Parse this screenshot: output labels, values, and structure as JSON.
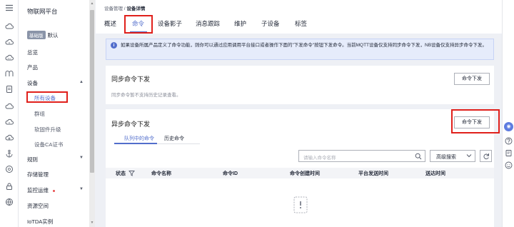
{
  "sidebar": {
    "title": "物联网平台",
    "instance_tag": "基础版",
    "instance_default": "默认",
    "items": [
      {
        "label": "总览"
      },
      {
        "label": "产品"
      },
      {
        "label": "设备"
      },
      {
        "label": "所有设备"
      },
      {
        "label": "群组"
      },
      {
        "label": "软固件升级"
      },
      {
        "label": "设备CA证书"
      },
      {
        "label": "规则"
      },
      {
        "label": "存储管理"
      },
      {
        "label": "监控运维"
      },
      {
        "label": "资源空间"
      },
      {
        "label": "IoTDA实例"
      }
    ]
  },
  "breadcrumb": {
    "parent": "设备管理",
    "separator": " / ",
    "current": "设备详情"
  },
  "tabs": [
    "概述",
    "命令",
    "设备影子",
    "消息跟踪",
    "维护",
    "子设备",
    "标签"
  ],
  "info": {
    "text": "如果设备所属产品定义了命令功能，则你可以通过应用调用平台接口或者操作下面的\"下发命令\"按钮下发命令。当前MQTT设备仅支持同步命令下发，NB设备仅支持异步命令下发。"
  },
  "sync": {
    "title": "同步命令下发",
    "desc": "同步命令暂不支持历史记录查看。",
    "button": "命令下发"
  },
  "async": {
    "title": "异步命令下发",
    "button": "命令下发",
    "subtabs": [
      "队列中的命令",
      "历史命令"
    ],
    "search_placeholder": "请输入命令名称",
    "advanced_search": "高级搜索",
    "columns": [
      "状态",
      "命令名称",
      "命令ID",
      "命令创建时间",
      "平台发送时间",
      "送达时间"
    ]
  },
  "colors": {
    "accent": "#526ecc",
    "highlight": "#e0201b"
  }
}
